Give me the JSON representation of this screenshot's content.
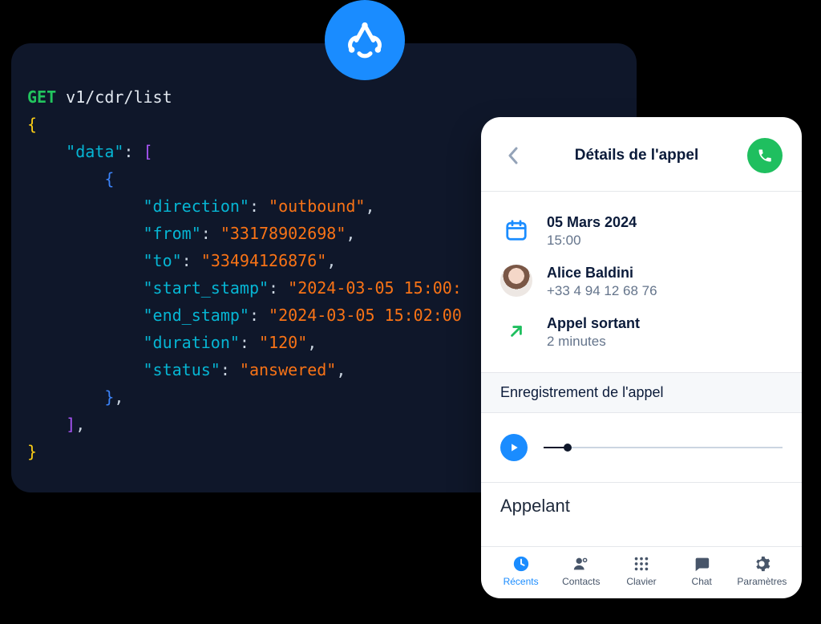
{
  "api": {
    "method": "GET",
    "path": "v1/cdr/list",
    "record": {
      "direction": "outbound",
      "from": "33178902698",
      "to": "33494126876",
      "start_stamp": "2024-03-05 15:00:",
      "end_stamp": "2024-03-05 15:02:00",
      "duration": "120",
      "status": "answered"
    }
  },
  "phone": {
    "title": "Détails de l'appel",
    "date_label": "05 Mars 2024",
    "time_label": "15:00",
    "contact_name": "Alice Baldini",
    "contact_number": "+33 4 94 12 68 76",
    "call_type_label": "Appel sortant",
    "duration_label": "2 minutes",
    "recording_section": "Enregistrement de l'appel",
    "caller_section": "Appelant",
    "tabs": {
      "recents": "Récents",
      "contacts": "Contacts",
      "keypad": "Clavier",
      "chat": "Chat",
      "settings": "Paramètres"
    }
  }
}
